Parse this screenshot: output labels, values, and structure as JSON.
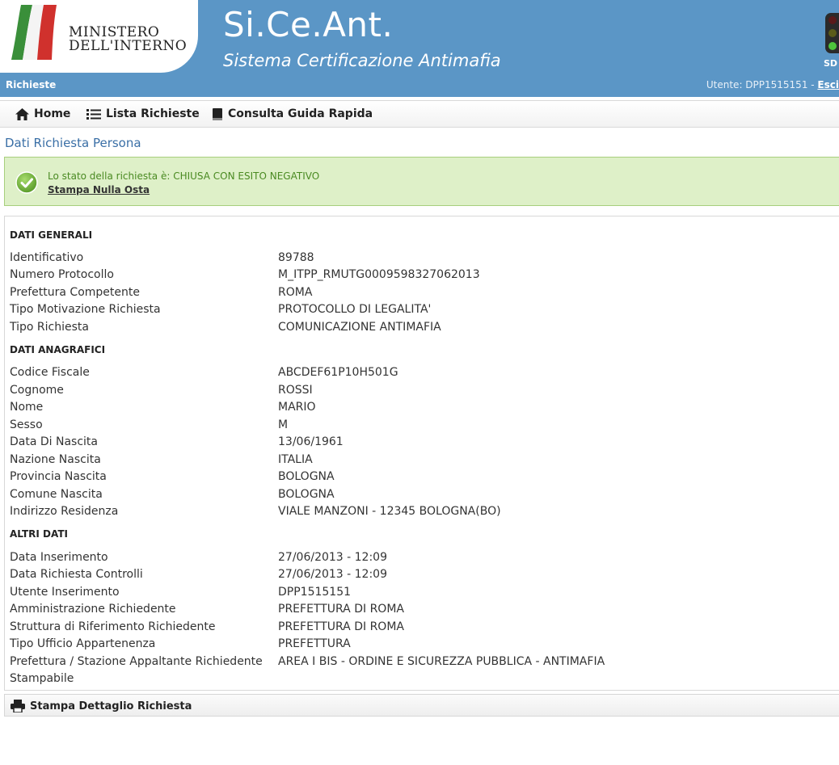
{
  "header": {
    "ministry_line1": "MINISTERO",
    "ministry_line2": "DELL'INTERNO",
    "app_title": "Si.Ce.Ant.",
    "app_subtitle": "Sistema Certificazione Antimafia",
    "badge": "SD",
    "breadcrumb": "Richieste",
    "user_text": "Utente: DPP1515151 - ",
    "exit_label": "Esci",
    "colors": {
      "banner": "#5b96c6",
      "accent_text": "#3a6fa6"
    }
  },
  "nav": {
    "home": "Home",
    "lista": "Lista Richieste",
    "guida": "Consulta Guida Rapida",
    "icons": [
      "home-icon",
      "list-icon",
      "book-icon"
    ]
  },
  "page_title": "Dati Richiesta Persona",
  "status": {
    "message": "Lo stato della richiesta è: CHIUSA CON ESITO NEGATIVO",
    "link": "Stampa Nulla Osta",
    "icon": "check-icon",
    "colors": {
      "background": "#def0c8",
      "text": "#4a8a22"
    }
  },
  "sections": {
    "generali": {
      "title": "DATI GENERALI",
      "rows": [
        {
          "label": "Identificativo",
          "value": "89788"
        },
        {
          "label": "Numero Protocollo",
          "value": "M_ITPP_RMUTG0009598327062013"
        },
        {
          "label": "Prefettura Competente",
          "value": "ROMA"
        },
        {
          "label": "Tipo Motivazione Richiesta",
          "value": "PROTOCOLLO DI LEGALITA'"
        },
        {
          "label": "Tipo Richiesta",
          "value": "COMUNICAZIONE ANTIMAFIA"
        }
      ]
    },
    "anagrafici": {
      "title": "DATI ANAGRAFICI",
      "rows": [
        {
          "label": "Codice Fiscale",
          "value": "ABCDEF61P10H501G"
        },
        {
          "label": "Cognome",
          "value": "ROSSI"
        },
        {
          "label": "Nome",
          "value": "MARIO"
        },
        {
          "label": "Sesso",
          "value": "M"
        },
        {
          "label": "Data Di Nascita",
          "value": "13/06/1961"
        },
        {
          "label": "Nazione Nascita",
          "value": "ITALIA"
        },
        {
          "label": "Provincia Nascita",
          "value": "BOLOGNA"
        },
        {
          "label": "Comune Nascita",
          "value": "BOLOGNA"
        },
        {
          "label": "Indirizzo Residenza",
          "value": "VIALE MANZONI - 12345 BOLOGNA(BO)"
        }
      ]
    },
    "altri": {
      "title": "ALTRI DATI",
      "rows": [
        {
          "label": "Data Inserimento",
          "value": "27/06/2013 - 12:09"
        },
        {
          "label": "Data Richiesta Controlli",
          "value": "27/06/2013 - 12:09"
        },
        {
          "label": "Utente Inserimento",
          "value": "DPP1515151"
        },
        {
          "label": "Amministrazione Richiedente",
          "value": "PREFETTURA DI ROMA"
        },
        {
          "label": "Struttura di Riferimento Richiedente",
          "value": "PREFETTURA DI ROMA"
        },
        {
          "label": "Tipo Ufficio Appartenenza",
          "value": "PREFETTURA"
        },
        {
          "label": "Prefettura / Stazione Appaltante Richiedente",
          "value": "AREA I BIS - ORDINE E SICUREZZA PUBBLICA - ANTIMAFIA"
        },
        {
          "label": "Stampabile",
          "value": ""
        }
      ]
    }
  },
  "footer": {
    "print_label": "Stampa Dettaglio Richiesta",
    "icon": "printer-icon"
  }
}
